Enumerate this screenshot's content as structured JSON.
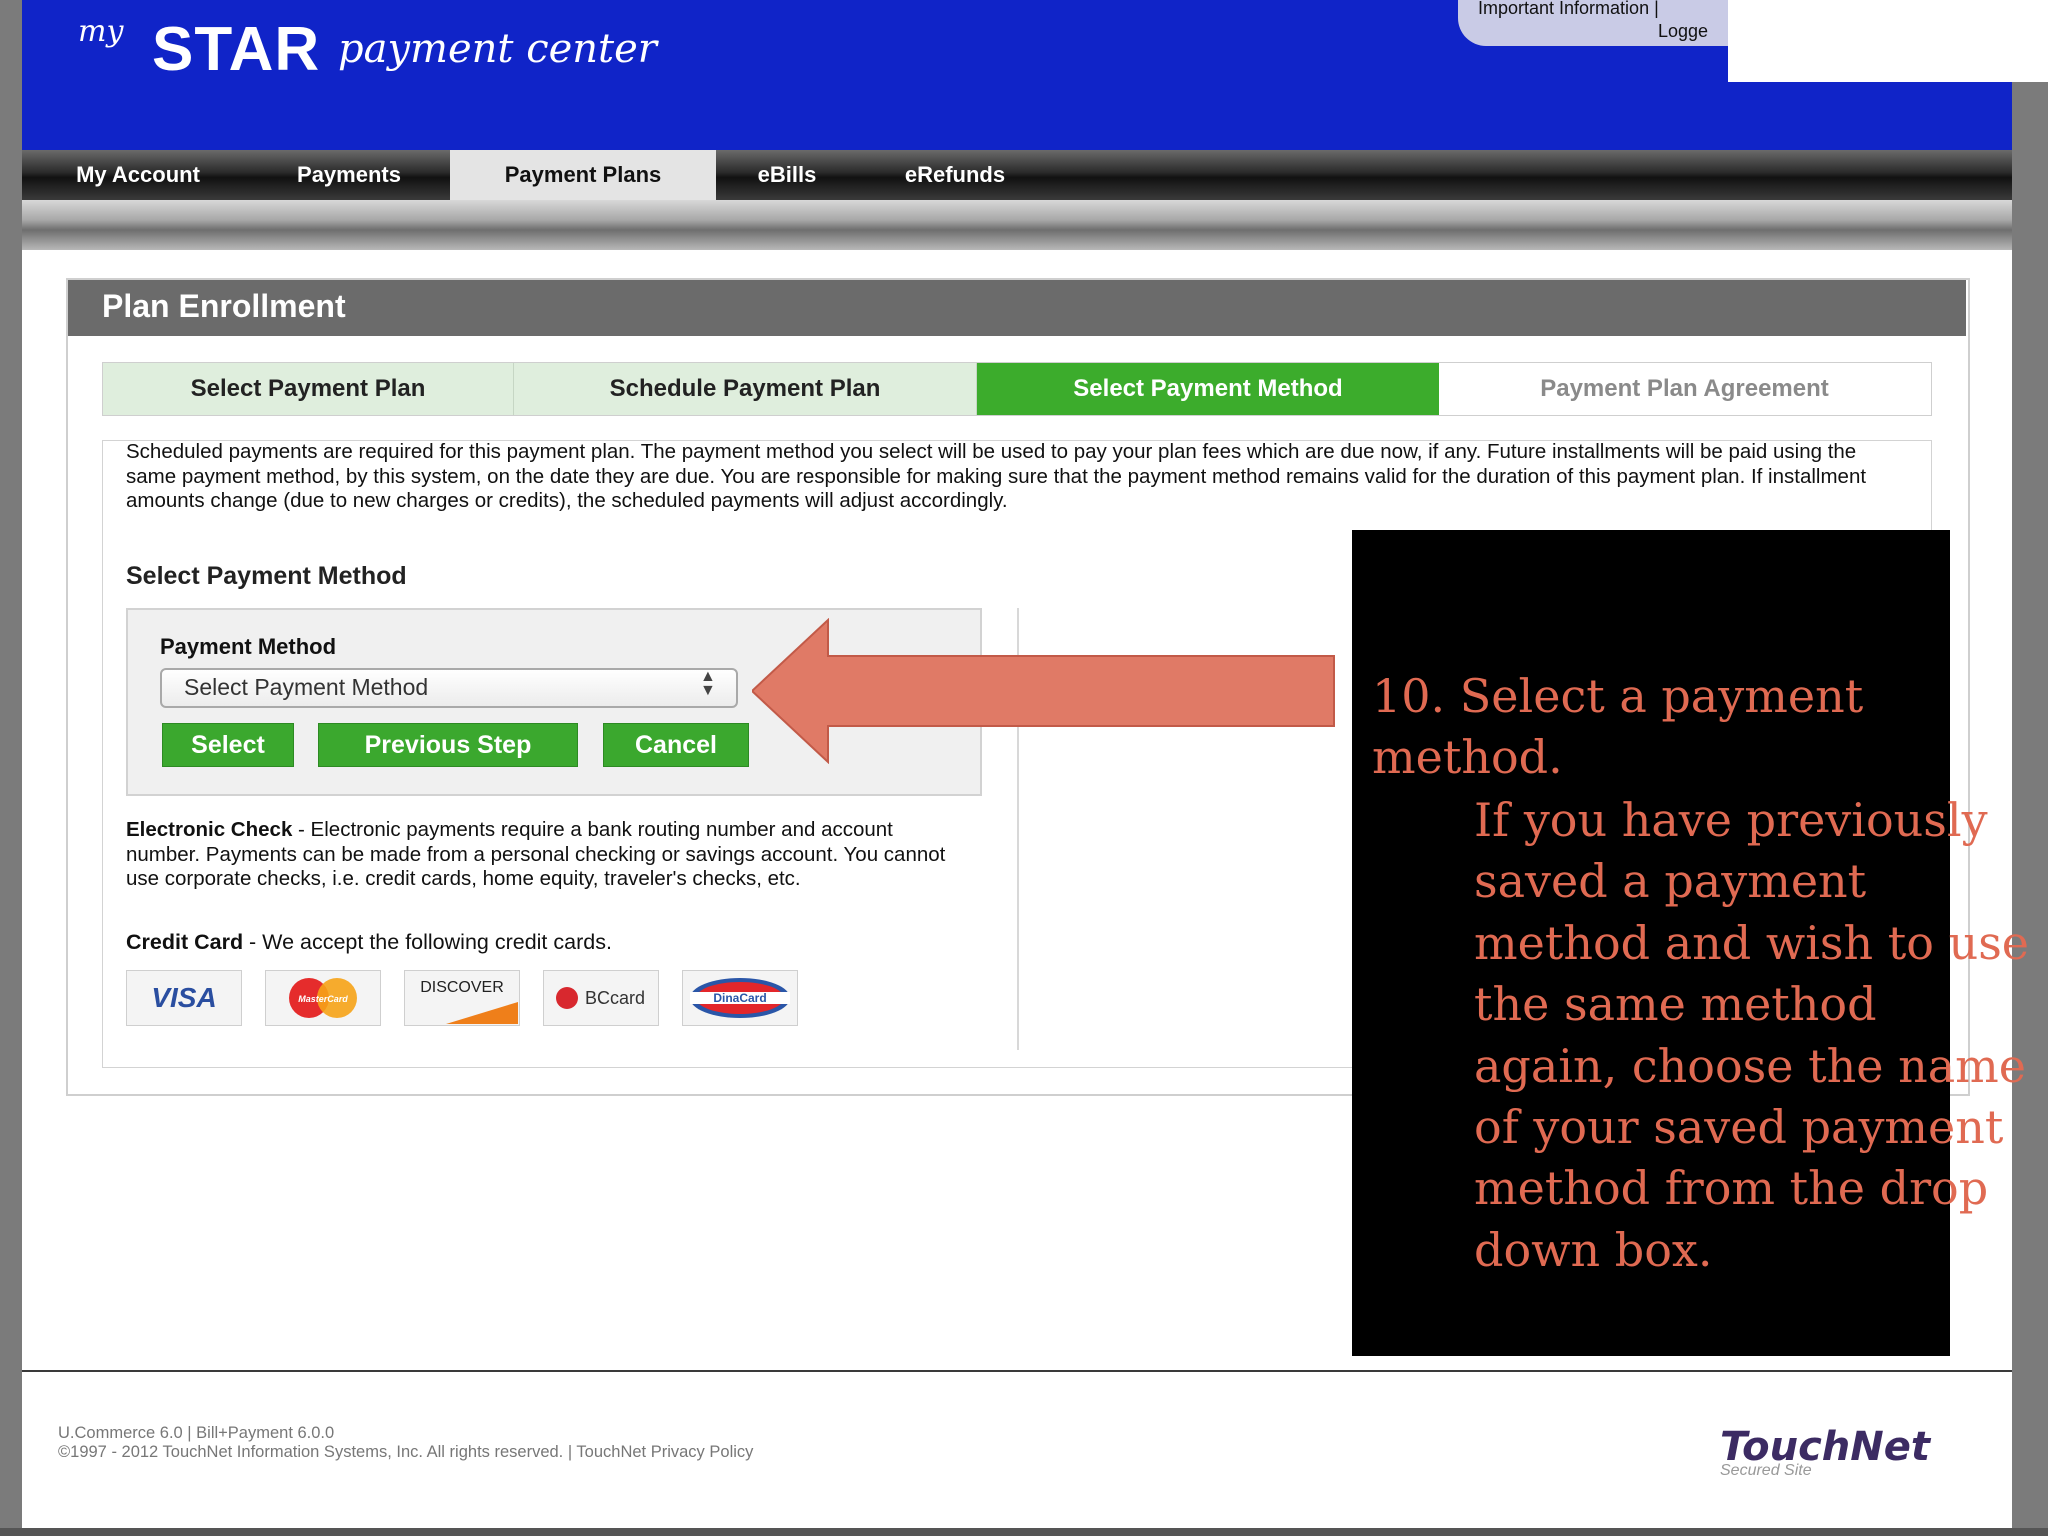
{
  "header": {
    "logo_my": "my",
    "logo_star": "STAR",
    "logo_sub": "payment center",
    "toplinks": {
      "line1": "Important Information |",
      "line2": "Logge"
    }
  },
  "nav": {
    "items": [
      "My Account",
      "Payments",
      "Payment Plans",
      "eBills",
      "eRefunds"
    ],
    "active": "Payment Plans"
  },
  "panel": {
    "title": "Plan Enrollment"
  },
  "steps": [
    "Select Payment Plan",
    "Schedule Payment Plan",
    "Select Payment Method",
    "Payment Plan Agreement"
  ],
  "description": "Scheduled payments are required for this payment plan. The payment method you select will be used to pay your plan fees which are due now, if any. Future installments will be paid using the same payment method, by this system, on the date they are due. You are responsible for making sure that the payment method remains valid for the duration of this payment plan. If installment amounts change (due to new charges or credits), the scheduled payments will adjust accordingly.",
  "section_heading": "Select Payment Method",
  "form": {
    "label": "Payment Method",
    "select_value": "Select Payment Method",
    "buttons": {
      "select": "Select",
      "previous": "Previous Step",
      "cancel": "Cancel"
    }
  },
  "info": {
    "echeck_title": "Electronic Check",
    "echeck_text": " - Electronic payments require a bank routing number and account number. Payments can be made from a personal checking or savings account. You cannot use corporate checks, i.e. credit cards, home equity, traveler's checks, etc.",
    "credit_title": "Credit Card",
    "credit_text": " - We accept the following credit cards."
  },
  "cards": [
    "VISA",
    "MasterCard",
    "DISCOVER",
    "BCcard",
    "DinaCard"
  ],
  "annotation": {
    "line1": "10. Select a payment method.",
    "line2": "If you have previously saved a payment method and wish to use the same method again, choose the name of your saved payment method from the drop down box."
  },
  "footer": {
    "version": "U.Commerce 6.0 | Bill+Payment 6.0.0",
    "copyright": "©1997 - 2012 TouchNet Information Systems, Inc. All rights reserved. | TouchNet Privacy Policy",
    "brand": "TouchNet",
    "brand_sub": "Secured Site"
  },
  "colors": {
    "header_blue": "#1024c8",
    "button_green": "#3ba82e",
    "annotation_text": "#e06a52",
    "arrow": "#e07a66"
  }
}
